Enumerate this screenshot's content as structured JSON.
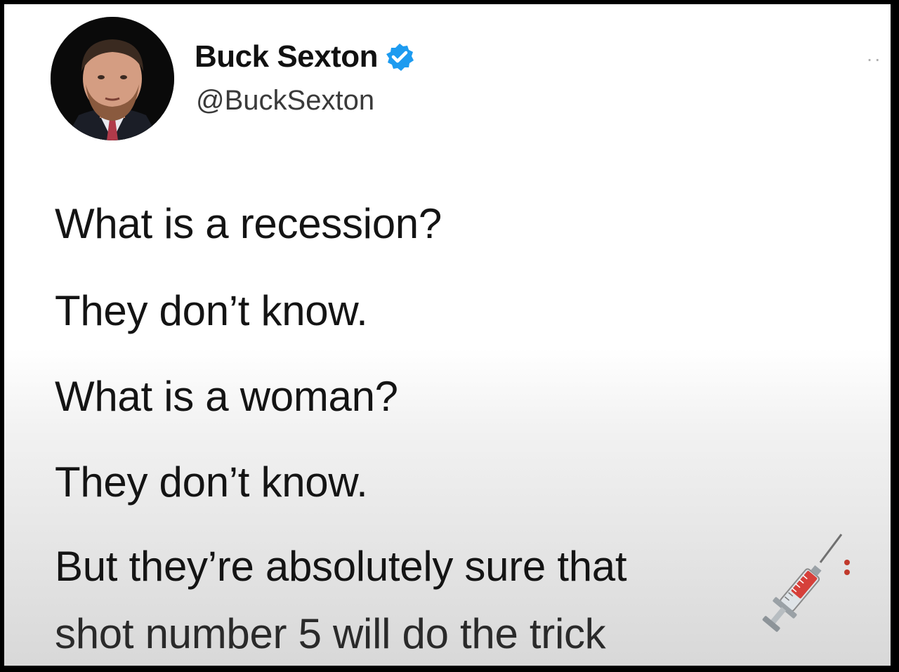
{
  "tweet": {
    "author_name": "Buck Sexton",
    "author_handle": "@BuckSexton",
    "verified": true,
    "verified_color": "#1d9bf0",
    "lines": [
      "What is a recession?",
      "They don’t know.",
      "What is a woman?",
      "They don’t know.",
      "But they’re absolutely sure that",
      "shot number 5 will do the trick"
    ],
    "emoji": "syringe-icon"
  },
  "menu": {
    "more_label": "··"
  }
}
